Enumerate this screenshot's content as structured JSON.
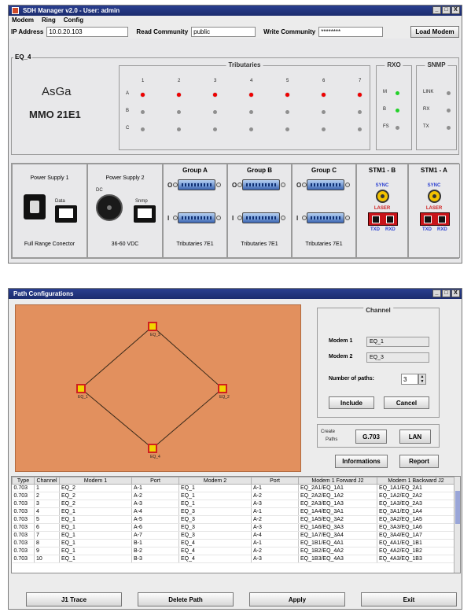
{
  "sdh": {
    "title": "SDH Manager v2.0 - User: admin",
    "window_buttons": [
      "_",
      "□",
      "X"
    ],
    "menus": [
      "Modem",
      "Ring",
      "Config"
    ],
    "ip_label": "IP Address",
    "ip_value": "10.0.20.103",
    "read_label": "Read Community",
    "read_value": "public",
    "write_label": "Write Community",
    "write_value": "********",
    "load_button": "Load Modem",
    "equipment": "EQ_4",
    "brand": "AsGa",
    "model": "MMO 21E1",
    "tributaries_title": "Tributaries",
    "trib_columns": [
      "1",
      "2",
      "3",
      "4",
      "5",
      "6",
      "7"
    ],
    "trib_rows": [
      {
        "label": "A",
        "states": [
          "red",
          "red",
          "red",
          "red",
          "red",
          "red",
          "red"
        ]
      },
      {
        "label": "B",
        "states": [
          "gray",
          "gray",
          "gray",
          "gray",
          "gray",
          "gray",
          "gray"
        ]
      },
      {
        "label": "C",
        "states": [
          "gray",
          "gray",
          "gray",
          "gray",
          "gray",
          "gray",
          "gray"
        ]
      }
    ],
    "rxo_title": "RXO",
    "rxo_items": [
      {
        "label": "M",
        "state": "green"
      },
      {
        "label": "B",
        "state": "green"
      },
      {
        "label": "FS",
        "state": "gray"
      }
    ],
    "snmp_title": "SNMP",
    "snmp_items": [
      {
        "label": "LINK",
        "state": "gray"
      },
      {
        "label": "RX",
        "state": "gray"
      },
      {
        "label": "TX",
        "state": "gray"
      }
    ],
    "ps1_title": "Power Supply 1",
    "ps1_data": "Data",
    "ps1_footer": "Full Range Conector",
    "ps2_title": "Power Supply 2",
    "ps2_dc": "DC",
    "ps2_snmp": "Snmp",
    "ps2_footer": "36-60 VDC",
    "groups": [
      {
        "title": "Group A",
        "footer": "Tributaries 7E1"
      },
      {
        "title": "Group B",
        "footer": "Tributaries 7E1"
      },
      {
        "title": "Group C",
        "footer": "Tributaries 7E1"
      }
    ],
    "port_o": "O",
    "port_i": "I",
    "stm": [
      {
        "title": "STM1 - B",
        "sync": "SYNC",
        "laser": "LASER",
        "tx": "TXD",
        "rx": "RXD"
      },
      {
        "title": "STM1 - A",
        "sync": "SYNC",
        "laser": "LASER",
        "tx": "TXD",
        "rx": "RXD"
      }
    ]
  },
  "path": {
    "title": "Path Configurations",
    "window_buttons": [
      "_",
      "□",
      "X"
    ],
    "nodes": [
      "EQ_3",
      "EQ_1",
      "EQ_2",
      "EQ_4"
    ],
    "channel_title": "Channel",
    "modem1_label": "Modem 1",
    "modem1_value": "EQ_1",
    "modem2_label": "Modem 2",
    "modem2_value": "EQ_3",
    "npaths_label": "Number of paths:",
    "npaths_value": "3",
    "include_button": "Include",
    "cancel_button": "Cancel",
    "create_label": "Create",
    "paths_label": "Paths",
    "g703_button": "G.703",
    "lan_button": "LAN",
    "info_button": "Informations",
    "report_button": "Report",
    "table_headers": [
      "Type",
      "Channel",
      "Modem 1",
      "Port",
      "Modem 2",
      "Port",
      "Modem 1 Forward J2",
      "Modem 1 Backward J2"
    ],
    "table_rows": [
      [
        "0.703",
        "1",
        "EQ_2",
        "A-1",
        "EQ_1",
        "A-1",
        "EQ_2A1/EQ_1A1",
        "EQ_1A1/EQ_2A1"
      ],
      [
        "0.703",
        "2",
        "EQ_2",
        "A-2",
        "EQ_1",
        "A-2",
        "EQ_2A2/EQ_1A2",
        "EQ_1A2/EQ_2A2"
      ],
      [
        "0.703",
        "3",
        "EQ_2",
        "A-3",
        "EQ_1",
        "A-3",
        "EQ_2A3/EQ_1A3",
        "EQ_1A3/EQ_2A3"
      ],
      [
        "0.703",
        "4",
        "EQ_1",
        "A-4",
        "EQ_3",
        "A-1",
        "EQ_1A4/EQ_3A1",
        "EQ_3A1/EQ_1A4"
      ],
      [
        "0.703",
        "5",
        "EQ_1",
        "A-5",
        "EQ_3",
        "A-2",
        "EQ_1A5/EQ_3A2",
        "EQ_3A2/EQ_1A5"
      ],
      [
        "0.703",
        "6",
        "EQ_1",
        "A-6",
        "EQ_3",
        "A-3",
        "EQ_1A6/EQ_3A3",
        "EQ_3A3/EQ_1A6"
      ],
      [
        "0.703",
        "7",
        "EQ_1",
        "A-7",
        "EQ_3",
        "A-4",
        "EQ_1A7/EQ_3A4",
        "EQ_3A4/EQ_1A7"
      ],
      [
        "0.703",
        "8",
        "EQ_1",
        "B-1",
        "EQ_4",
        "A-1",
        "EQ_1B1/EQ_4A1",
        "EQ_4A1/EQ_1B1"
      ],
      [
        "0.703",
        "9",
        "EQ_1",
        "B-2",
        "EQ_4",
        "A-2",
        "EQ_1B2/EQ_4A2",
        "EQ_4A2/EQ_1B2"
      ],
      [
        "0.703",
        "10",
        "EQ_1",
        "B-3",
        "EQ_4",
        "A-3",
        "EQ_1B3/EQ_4A3",
        "EQ_4A3/EQ_1B3"
      ]
    ],
    "j1_button": "J1 Trace",
    "delete_button": "Delete Path",
    "apply_button": "Apply",
    "exit_button": "Exit"
  },
  "colors": {
    "title_bar": "#1b2c6e",
    "canvas": "#e2905e",
    "led_alarm": "#f00000",
    "led_ok": "#23d12a",
    "led_off": "#8f8f8f"
  }
}
